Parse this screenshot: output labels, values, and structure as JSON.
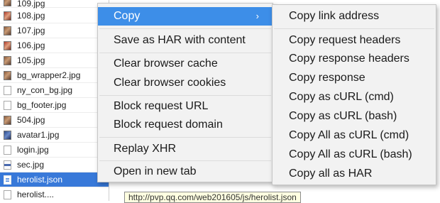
{
  "file_list": {
    "items": [
      {
        "name": "109.jpg",
        "icon": "image-icon"
      },
      {
        "name": "108.jpg",
        "icon": "image-icon"
      },
      {
        "name": "107.jpg",
        "icon": "image-icon"
      },
      {
        "name": "106.jpg",
        "icon": "image-icon"
      },
      {
        "name": "105.jpg",
        "icon": "image-icon"
      },
      {
        "name": "bg_wrapper2.jpg",
        "icon": "image-icon"
      },
      {
        "name": "ny_con_bg.jpg",
        "icon": "document-icon"
      },
      {
        "name": "bg_footer.jpg",
        "icon": "document-icon"
      },
      {
        "name": "504.jpg",
        "icon": "image-icon"
      },
      {
        "name": "avatar1.jpg",
        "icon": "image-icon"
      },
      {
        "name": "login.jpg",
        "icon": "document-icon"
      },
      {
        "name": "sec.jpg",
        "icon": "document-icon"
      },
      {
        "name": "herolist.json",
        "icon": "json-icon",
        "selected": true
      },
      {
        "name": "herolist....",
        "icon": "document-icon"
      }
    ],
    "selected_color": "#3879d9"
  },
  "tooltip": {
    "text": "http://pvp.qq.com/web201605/js/herolist.json"
  },
  "context_menu": {
    "items": [
      {
        "label": "Copy",
        "highlighted": true,
        "has_submenu": true,
        "arrow": "›"
      },
      {
        "label": "Save as HAR with content"
      },
      {
        "label": "Clear browser cache"
      },
      {
        "label": "Clear browser cookies"
      },
      {
        "label": "Block request URL"
      },
      {
        "label": "Block request domain"
      },
      {
        "label": "Replay XHR"
      },
      {
        "label": "Open in new tab"
      }
    ],
    "highlight_color": "#3d8ee8"
  },
  "copy_submenu": {
    "items": [
      {
        "label": "Copy link address"
      },
      {
        "label": "Copy request headers"
      },
      {
        "label": "Copy response headers"
      },
      {
        "label": "Copy response"
      },
      {
        "label": "Copy as cURL (cmd)"
      },
      {
        "label": "Copy as cURL (bash)"
      },
      {
        "label": "Copy All as cURL (cmd)"
      },
      {
        "label": "Copy All as cURL (bash)"
      },
      {
        "label": "Copy all as HAR"
      }
    ]
  }
}
